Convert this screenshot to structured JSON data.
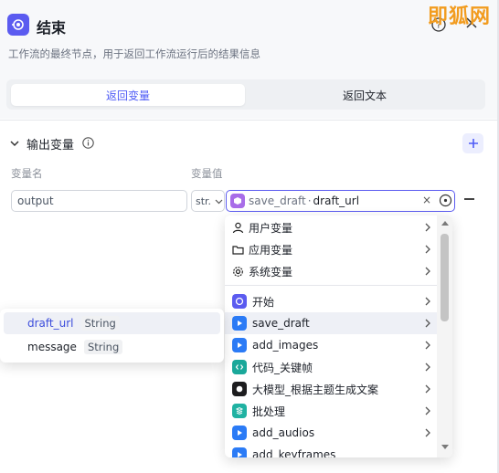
{
  "header": {
    "title": "结束",
    "description": "工作流的最终节点，用于返回工作流运行后的结果信息",
    "watermark": "即狐网"
  },
  "segment": {
    "tabs": [
      {
        "label": "返回变量",
        "active": true
      },
      {
        "label": "返回文本",
        "active": false
      }
    ]
  },
  "output_section": {
    "title": "输出变量",
    "col_name": "变量名",
    "col_value": "变量值",
    "row": {
      "name": "output",
      "type": "str.",
      "value_node": "save_draft",
      "value_sep": "·",
      "value_var": "draft_url"
    }
  },
  "dropdown": {
    "groups": [
      {
        "label": "用户变量",
        "icon": "user-icon"
      },
      {
        "label": "应用变量",
        "icon": "folder-icon"
      },
      {
        "label": "系统变量",
        "icon": "gear-icon"
      }
    ],
    "nodes": [
      {
        "label": "开始",
        "icon": "start-icon",
        "color": "#5b5bf0",
        "highlight": false
      },
      {
        "label": "save_draft",
        "icon": "plugin-icon",
        "color": "#2b7bf6",
        "highlight": true
      },
      {
        "label": "add_images",
        "icon": "plugin-icon",
        "color": "#2b7bf6",
        "highlight": false
      },
      {
        "label": "代码_关键帧",
        "icon": "code-icon",
        "color": "#1aa89a",
        "highlight": false
      },
      {
        "label": "大模型_根据主题生成文案",
        "icon": "llm-icon",
        "color": "#1d1d1f",
        "highlight": false
      },
      {
        "label": "批处理",
        "icon": "batch-icon",
        "color": "#20b2a2",
        "highlight": false
      },
      {
        "label": "add_audios",
        "icon": "plugin-icon",
        "color": "#2b7bf6",
        "highlight": false
      },
      {
        "label": "add_keyframes",
        "icon": "plugin-icon",
        "color": "#2b7bf6",
        "highlight": false
      }
    ]
  },
  "subpopup": {
    "items": [
      {
        "name": "draft_url",
        "type": "String",
        "highlight": true
      },
      {
        "name": "message",
        "type": "String",
        "highlight": false
      }
    ]
  },
  "colors": {
    "accent": "#5b5bf0",
    "watermark": "#f29c1f"
  }
}
